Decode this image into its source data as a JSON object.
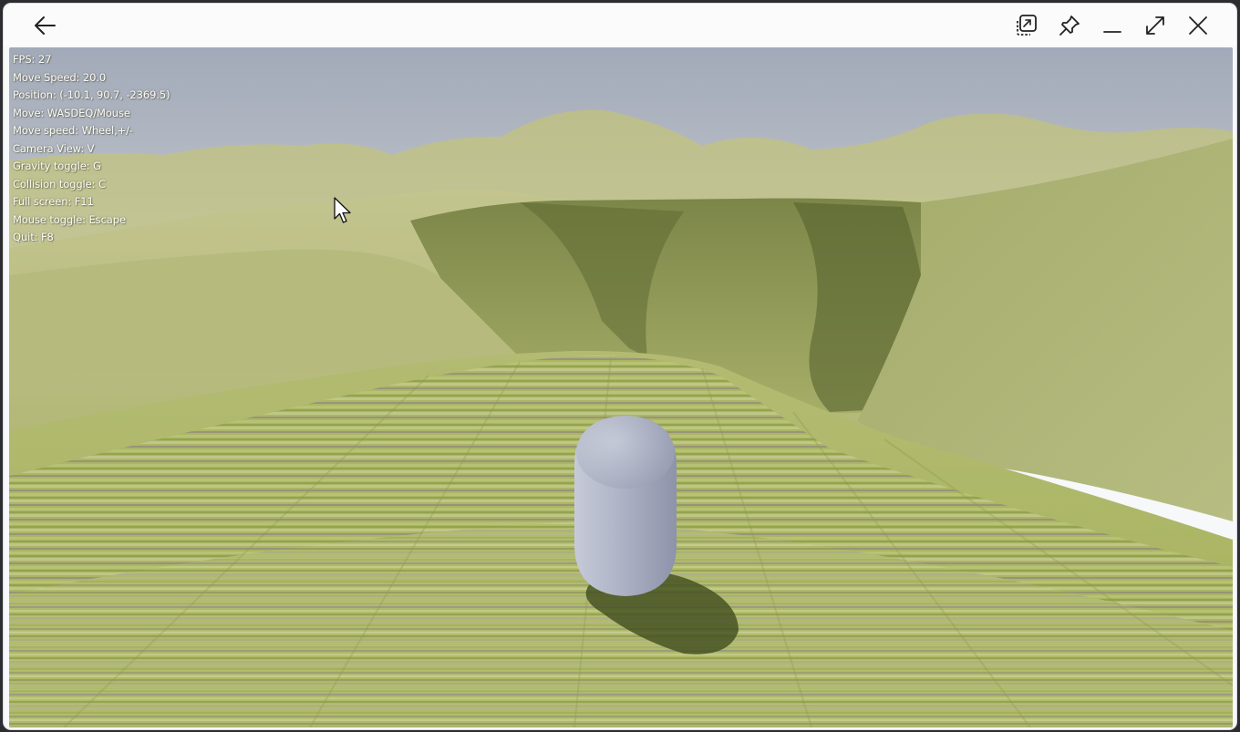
{
  "window": {
    "buttons": {
      "back": "back-arrow-icon",
      "overlay": "picture-in-picture-icon",
      "pin": "pin-icon",
      "minimize": "minimize-icon",
      "maximize": "expand-icon",
      "close": "close-icon"
    }
  },
  "hud": {
    "fps": "FPS: 27",
    "move_speed": "Move Speed: 20.0",
    "position": "Position: (-10.1, 90.7, -2369.5)",
    "move": "Move: WASDEQ/Mouse",
    "move_speed_keys": "Move speed: Wheel,+/-",
    "camera_view": "Camera View: V",
    "gravity_toggle": "Gravity toggle: G",
    "collision_toggle": "Collision toggle: C",
    "full_screen": "Full screen: F11",
    "mouse_toggle": "Mouse toggle: Escape",
    "quit": "Quit: F8"
  },
  "scene": {
    "sky_color_top": "#a3abbb",
    "sky_color_horizon": "#c9cdd0",
    "hill_color": "#c3c593",
    "grass_color": "#a9b564",
    "player_color": "#a7adc2",
    "shadow_color": "#3d4a1c"
  }
}
